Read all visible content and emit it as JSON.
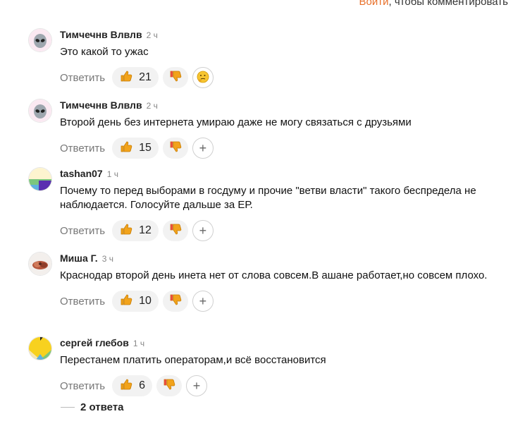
{
  "login_prompt": {
    "link": "Войти",
    "rest": ", чтобы комментировать"
  },
  "reply_label": "Ответить",
  "comments": [
    {
      "author": "Тимчечнв Влвлв",
      "time": "2 ч",
      "text": "Это какой то ужас",
      "likes": "21",
      "avatar": "alien-avatar",
      "extra_reaction": "thinking-emoji"
    },
    {
      "author": "Тимчечнв Влвлв",
      "time": "2 ч",
      "text": "Второй день без интернета умираю даже не могу связаться с друзьями",
      "likes": "15",
      "avatar": "alien-avatar",
      "extra_reaction": "add-reaction"
    },
    {
      "author": "tashan07",
      "time": "1 ч",
      "text": "Почему то перед выборами в госдуму и прочие \"ветви власти\" такого беспредела не наблюдается. Голосуйте дальше за ЕР.",
      "likes": "12",
      "avatar": "color-avatar",
      "extra_reaction": "add-reaction"
    },
    {
      "author": "Миша Г.",
      "time": "3 ч",
      "text": "Краснодар второй день инета нет от слова совсем.В ашане работает,но совсем плохо.",
      "likes": "10",
      "avatar": "photo-avatar",
      "extra_reaction": "add-reaction"
    },
    {
      "author": "сергей глебов",
      "time": "1 ч",
      "text": "Перестанем платить операторам,и всё восстановится",
      "likes": "6",
      "avatar": "yellow-avatar",
      "extra_reaction": "add-reaction"
    }
  ],
  "replies_toggle": "2 ответа",
  "colors": {
    "accent": "#e8702a",
    "pill_bg": "#f2f2f2",
    "like": "#f2a31b",
    "dislike": "#e94e3c"
  }
}
